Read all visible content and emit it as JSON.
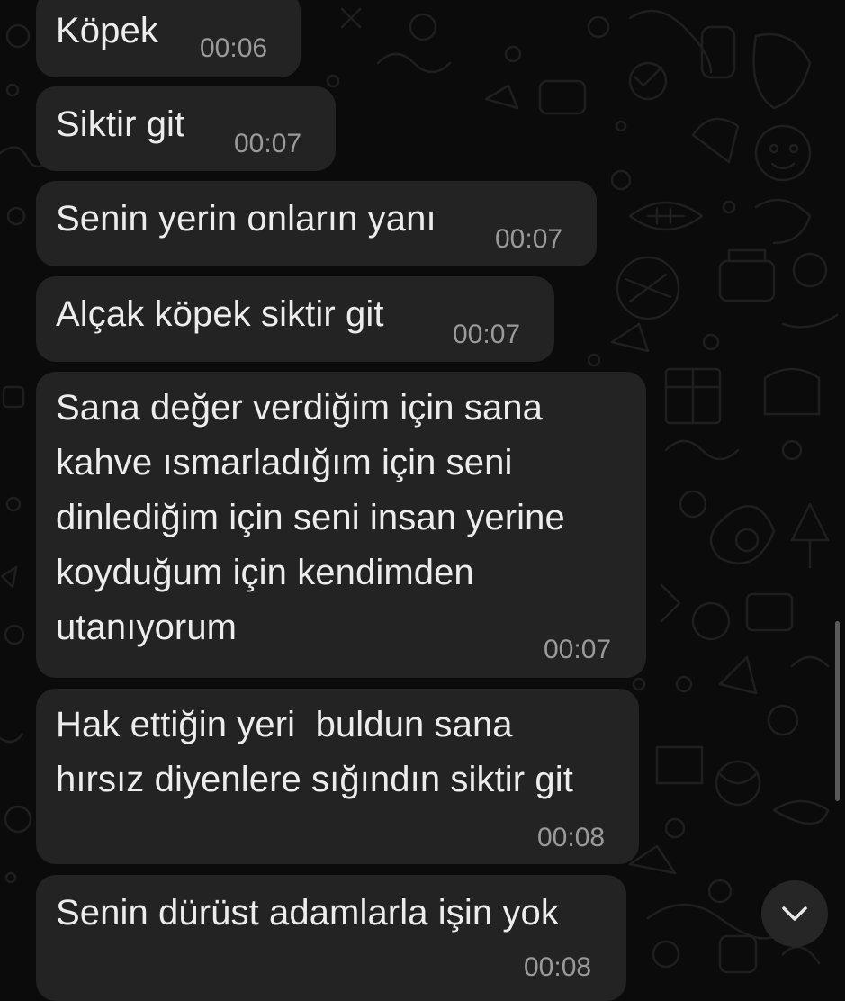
{
  "messages": [
    {
      "text": "Köpek",
      "time": "00:06"
    },
    {
      "text": "Siktir git",
      "time": "00:07"
    },
    {
      "text": "Senin yerin onların yanı",
      "time": "00:07"
    },
    {
      "text": "Alçak köpek siktir git",
      "time": "00:07"
    },
    {
      "text": "Sana değer verdiğim için sana\nkahve ısmarladığım için seni\ndinlediğim için seni insan yerine\nkoyduğum için kendimden\nutanıyorum",
      "time": "00:07"
    },
    {
      "text": "Hak ettiğin yeri  buldun sana\nhırsız diyenlere sığındın siktir git",
      "time": "00:08"
    },
    {
      "text": "Senin dürüst adamlarla işin yok",
      "time": "00:08"
    }
  ],
  "controls": {
    "scroll_down_icon": "chevron-down-icon"
  },
  "colors": {
    "background": "#0b0b0b",
    "bubble": "#232323",
    "text": "#ececec",
    "time": "#9a9a9a"
  }
}
